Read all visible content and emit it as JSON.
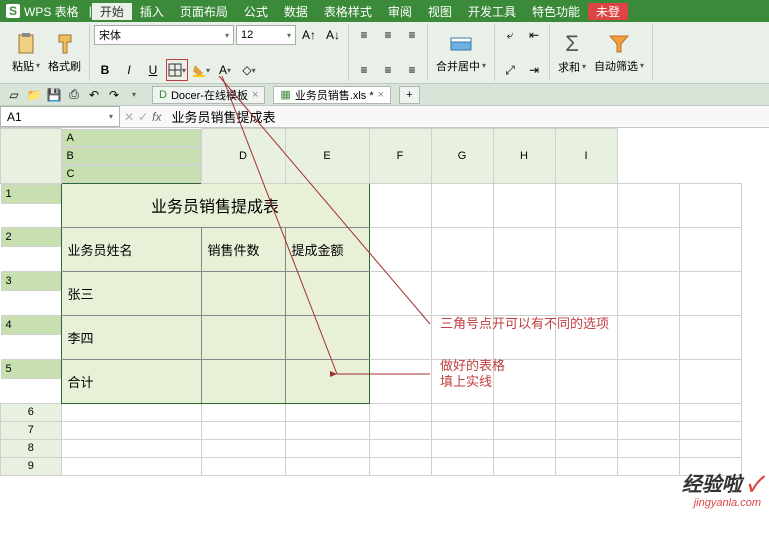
{
  "app": {
    "logo": "S",
    "name": "WPS 表格"
  },
  "menu": {
    "tabs": [
      "开始",
      "插入",
      "页面布局",
      "公式",
      "数据",
      "表格样式",
      "审阅",
      "视图",
      "开发工具",
      "特色功能",
      "未登"
    ],
    "active": 0
  },
  "ribbon": {
    "paste": "粘贴",
    "formatPainter": "格式刷",
    "font": "宋体",
    "fontSize": "12",
    "mergeCenter": "合并居中",
    "sum": "求和",
    "autoFilter": "自动筛选",
    "bold": "B",
    "italic": "I",
    "underline": "U"
  },
  "doctabs": {
    "t1": "Docer-在线模板",
    "t2": "业务员销售.xls *",
    "add": "+"
  },
  "cellref": "A1",
  "fx": "fx",
  "formula": "业务员销售提成表",
  "cols": [
    "A",
    "B",
    "C",
    "D",
    "E",
    "F",
    "G",
    "H",
    "I"
  ],
  "rows": [
    "1",
    "2",
    "3",
    "4",
    "5",
    "6",
    "7",
    "8",
    "9"
  ],
  "cells": {
    "title": "业务员销售提成表",
    "h1": "业务员姓名",
    "h2": "销售件数",
    "h3": "提成金额",
    "r3": "张三",
    "r4": "李四",
    "r5": "合计"
  },
  "annot": {
    "a1": "三角号点开可以有不同的选项",
    "a2a": "做好的表格",
    "a2b": "填上实线"
  },
  "watermark": {
    "text": "经验啦",
    "check": "✓",
    "url": "jingyanla.com"
  }
}
